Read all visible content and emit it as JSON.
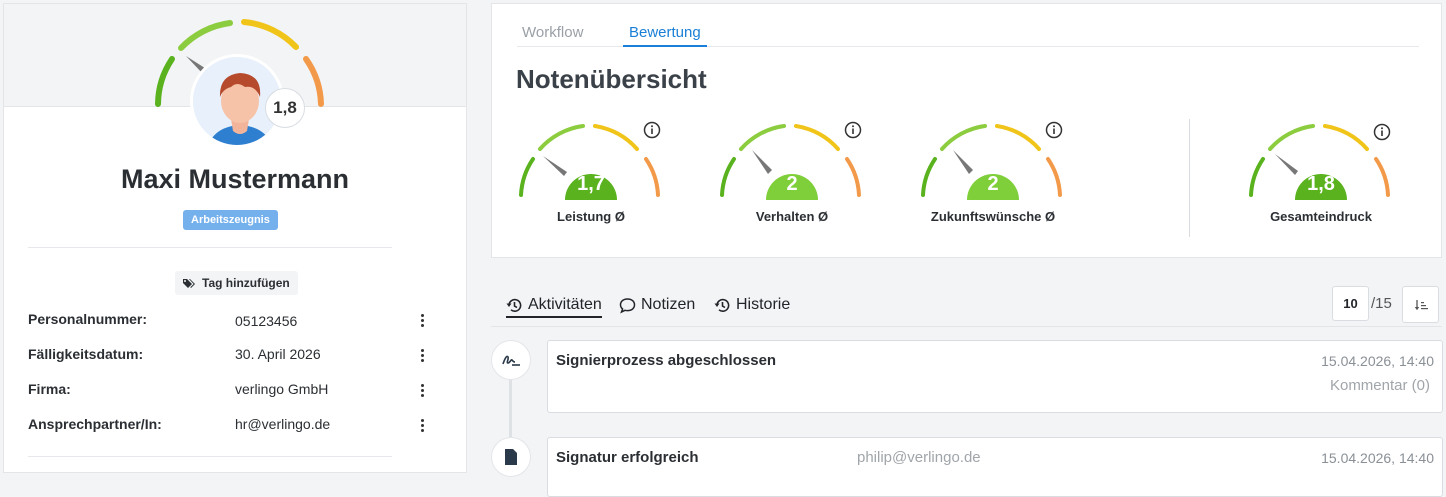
{
  "profile": {
    "overall_grade": "1,8",
    "name": "Maxi Mustermann",
    "badge": "Arbeitszeugnis",
    "tag_button": "Tag hinzufügen",
    "fields": [
      {
        "label": "Personalnummer:",
        "value": "05123456"
      },
      {
        "label": "Fälligkeitsdatum:",
        "value": "30. April 2026"
      },
      {
        "label": "Firma:",
        "value": "verlingo GmbH"
      },
      {
        "label": "Ansprechpartner/In:",
        "value": "hr@verlingo.de"
      }
    ]
  },
  "rating": {
    "tabs": [
      {
        "label": "Workflow",
        "active": false
      },
      {
        "label": "Bewertung",
        "active": true
      }
    ],
    "title": "Notenübersicht",
    "gauges": [
      {
        "value": "1,7",
        "label": "Leistung Ø",
        "color": "#5ab31e",
        "icon": "info-icon"
      },
      {
        "value": "2",
        "label": "Verhalten Ø",
        "color": "#7fcf3a",
        "icon": "info-icon"
      },
      {
        "value": "2",
        "label": "Zukunftswünsche Ø",
        "color": "#7fcf3a",
        "icon": "info-icon"
      },
      {
        "value": "1,8",
        "label": "Gesamteindruck",
        "color": "#5ab31e",
        "icon": "info-icon"
      }
    ]
  },
  "activities": {
    "tabs": [
      {
        "label": "Aktivitäten",
        "icon": "history-icon",
        "active": true
      },
      {
        "label": "Notizen",
        "icon": "comment-icon",
        "active": false
      },
      {
        "label": "Historie",
        "icon": "history-icon",
        "active": false
      }
    ],
    "page_size": "10",
    "page_total": "/15",
    "items": [
      {
        "title": "Signierprozess abgeschlossen",
        "time": "15.04.2026, 14:40",
        "comment": "Kommentar (0)",
        "icon": "signature-icon"
      },
      {
        "title": "Signatur erfolgreich",
        "user": "philip@verlingo.de",
        "time": "15.04.2026, 14:40",
        "icon": "file-signature-icon"
      }
    ]
  },
  "colors": {
    "accent": "#1a7fd6",
    "badge": "#74b0ec",
    "gauge_green": "#5ab31e",
    "gauge_yellow": "#f0c419",
    "gauge_orange": "#f39a4a"
  }
}
